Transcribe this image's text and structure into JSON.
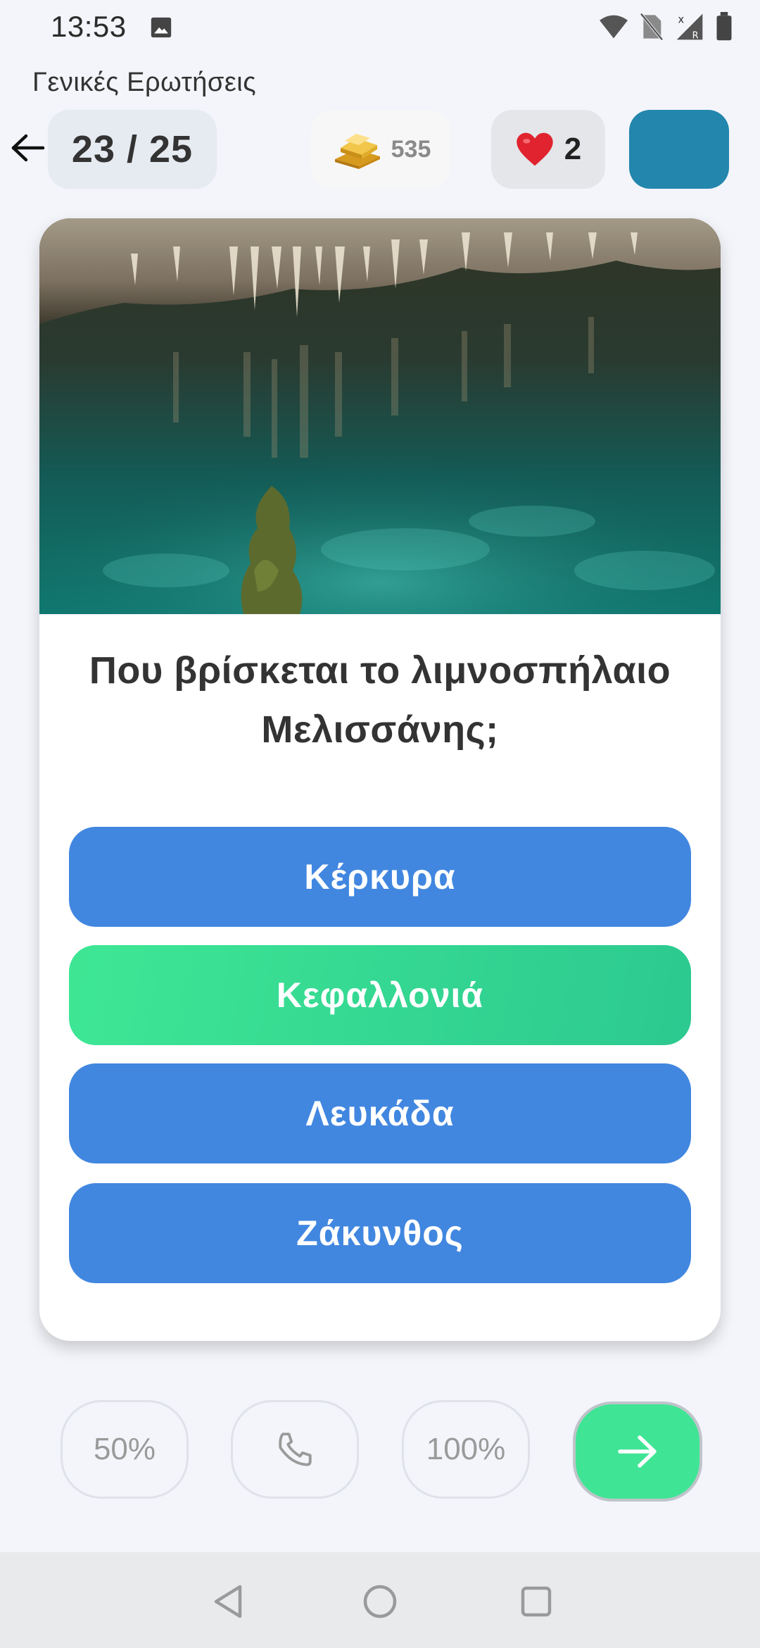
{
  "status_bar": {
    "time": "13:53",
    "icons": [
      "image-icon",
      "wifi-icon",
      "no-sim-icon",
      "signal-icon",
      "battery-icon"
    ]
  },
  "app": {
    "title": "Γενικές Ερωτήσεις"
  },
  "header": {
    "progress": "23 / 25",
    "gold": "535",
    "lives": "2",
    "avatar_color": "#2286ad"
  },
  "quiz": {
    "question": "Που βρίσκεται το λιμνοσπήλαιο Μελισσάνης;",
    "answers": [
      {
        "label": "Κέρκυρα",
        "state": "default"
      },
      {
        "label": "Κεφαλλονιά",
        "state": "correct"
      },
      {
        "label": "Λευκάδα",
        "state": "default"
      },
      {
        "label": "Ζάκυνθος",
        "state": "default"
      }
    ]
  },
  "lifelines": {
    "fifty_label": "50%",
    "phone_icon": "phone-icon",
    "hundred_label": "100%",
    "next_icon": "arrow-right-icon"
  },
  "colors": {
    "answer_default": "#4187e0",
    "answer_correct": "#3ee794",
    "next_button": "#3fe595",
    "background": "#f3f5fa"
  },
  "navigation_bar": {
    "icons": [
      "back-triangle-icon",
      "home-circle-icon",
      "recents-square-icon"
    ]
  }
}
